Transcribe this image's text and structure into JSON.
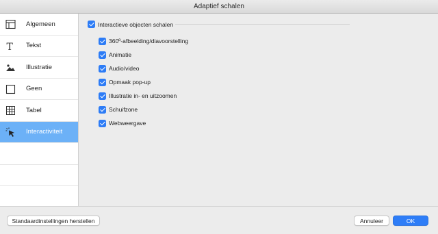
{
  "window": {
    "title": "Adaptief schalen"
  },
  "sidebar": {
    "items": [
      {
        "label": "Algemeen",
        "icon": "layout-icon"
      },
      {
        "label": "Tekst",
        "icon": "text-icon"
      },
      {
        "label": "Illustratie",
        "icon": "image-icon"
      },
      {
        "label": "Geen",
        "icon": "square-icon"
      },
      {
        "label": "Tabel",
        "icon": "table-icon"
      },
      {
        "label": "Interactiviteit",
        "icon": "pointer-click-icon",
        "selected": true
      }
    ]
  },
  "content": {
    "master": {
      "label": "Interactieve objecten schalen",
      "checked": true
    },
    "options": [
      {
        "label": "360º-afbeelding/diavoorstelling",
        "checked": true
      },
      {
        "label": "Animatie",
        "checked": true
      },
      {
        "label": "Audio/video",
        "checked": true
      },
      {
        "label": "Opmaak pop-up",
        "checked": true
      },
      {
        "label": "Illustratie in- en uitzoomen",
        "checked": true
      },
      {
        "label": "Schuifzone",
        "checked": true
      },
      {
        "label": "Webweergave",
        "checked": true
      }
    ]
  },
  "footer": {
    "reset_label": "Standaardinstellingen herstellen",
    "cancel_label": "Annuleer",
    "ok_label": "OK"
  },
  "colors": {
    "accent": "#2d7cf6",
    "selection": "#6cb1f7"
  }
}
